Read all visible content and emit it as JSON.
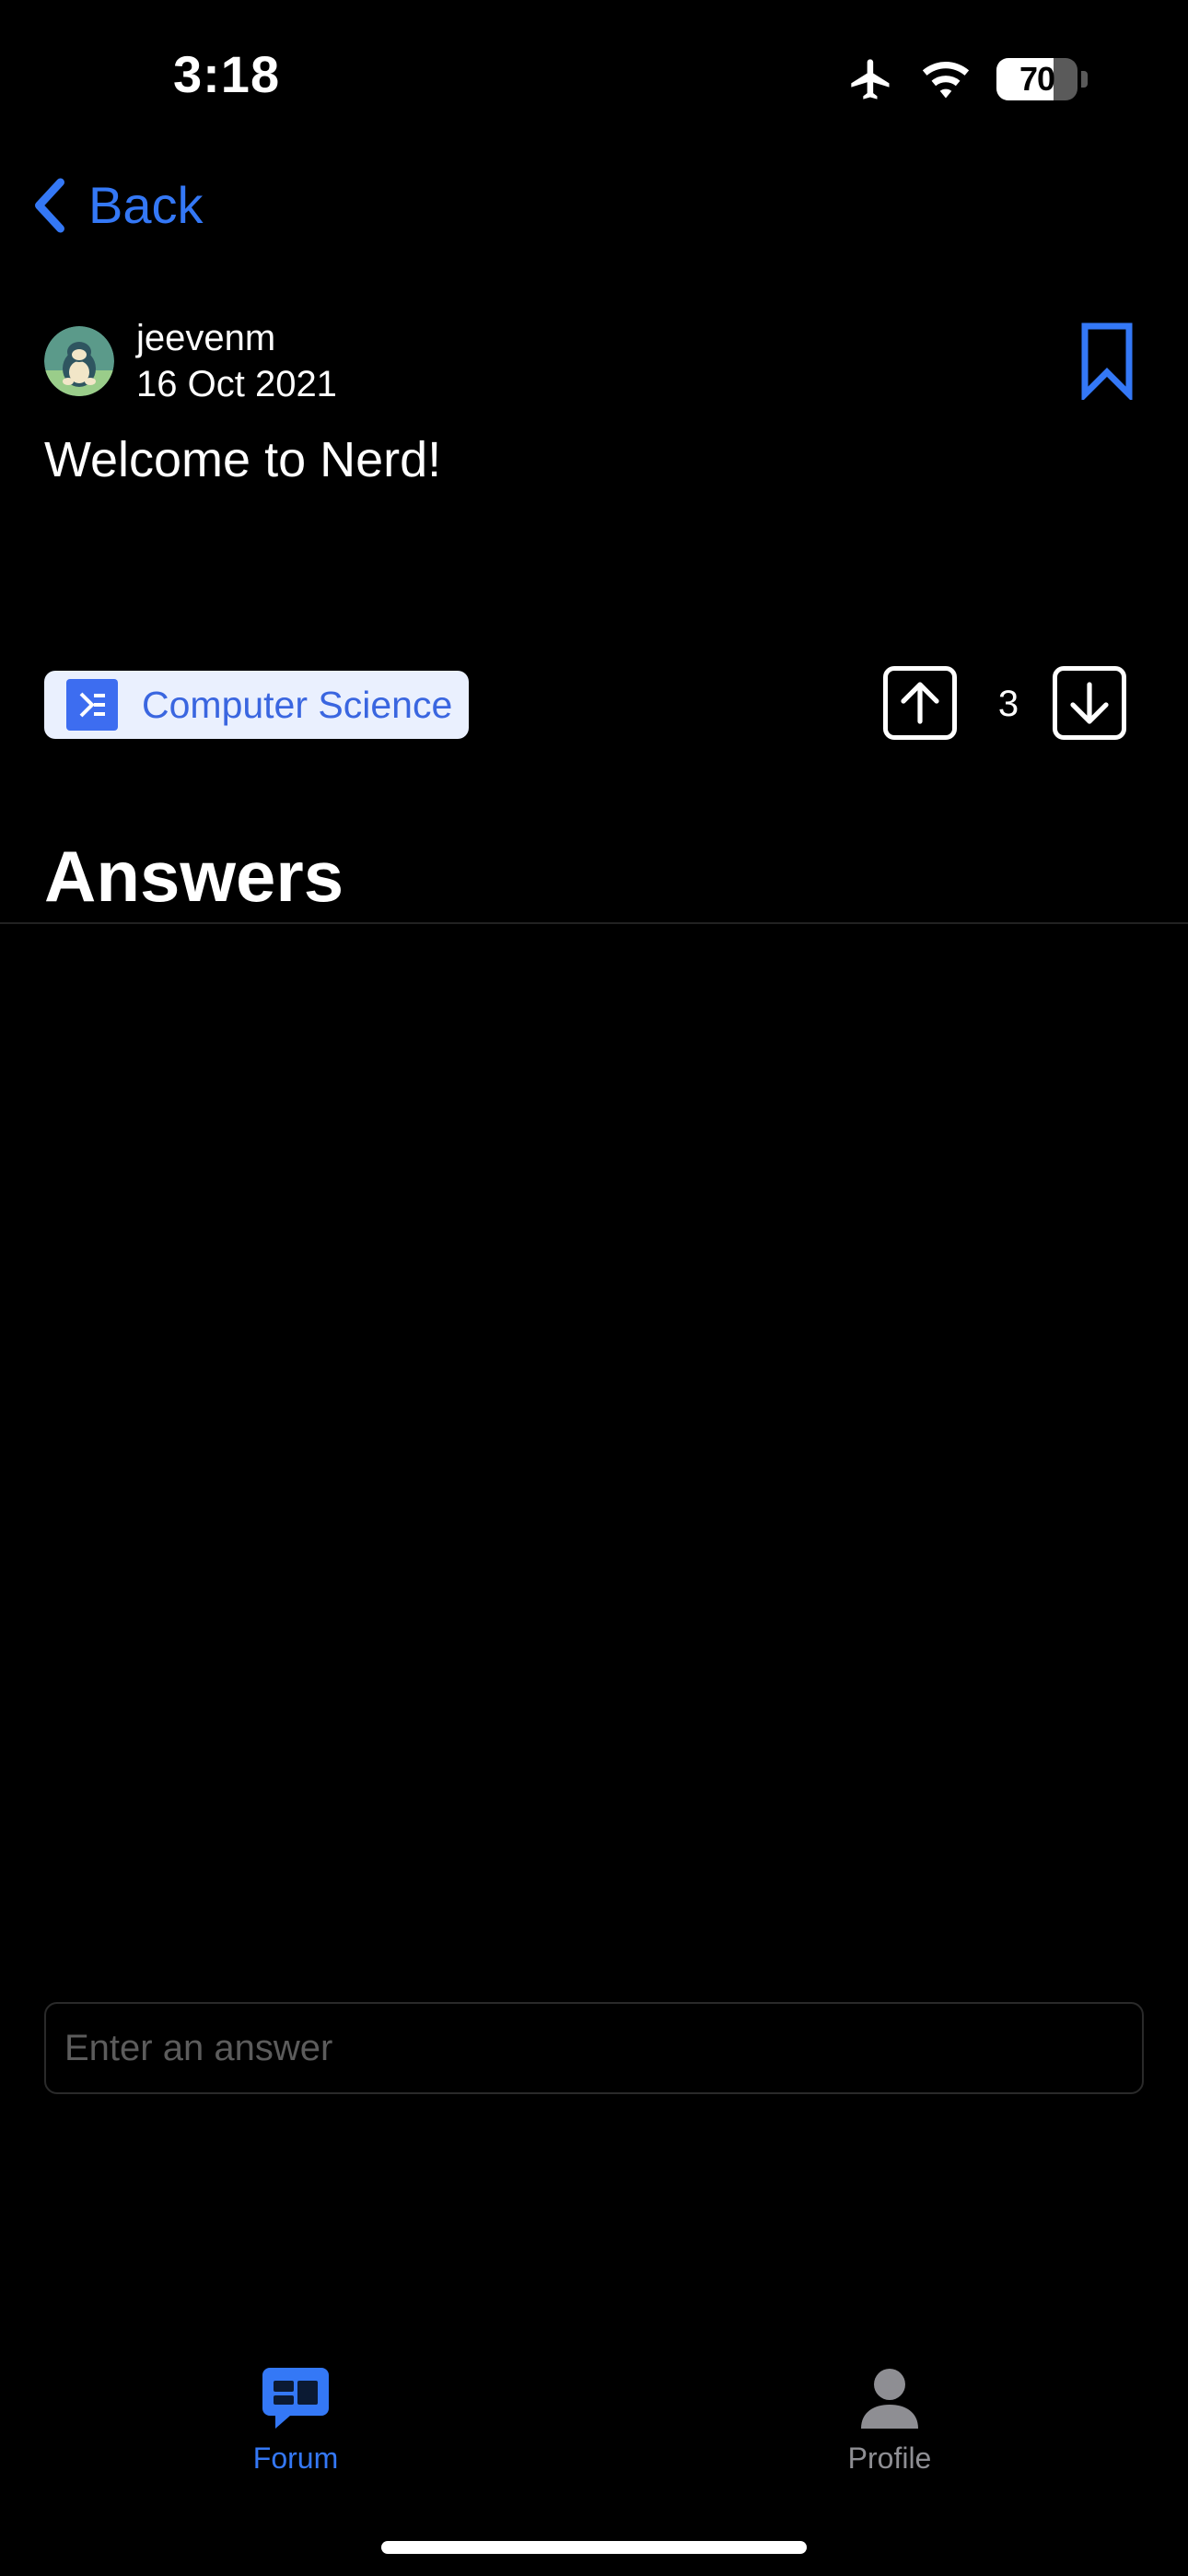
{
  "status_bar": {
    "time": "3:18",
    "battery_level": "70",
    "battery_fraction": 0.7,
    "icons": [
      "airplane-icon",
      "wifi-icon",
      "battery-icon"
    ]
  },
  "nav": {
    "back_label": "Back"
  },
  "post": {
    "author": "jeevenm",
    "date": "16 Oct 2021",
    "title": "Welcome to Nerd!",
    "tag": "Computer Science",
    "vote_count": "3"
  },
  "answers": {
    "heading": "Answers",
    "input_placeholder": "Enter an answer"
  },
  "tabbar": {
    "forum_label": "Forum",
    "profile_label": "Profile"
  },
  "colors": {
    "accent": "#3478f6",
    "tag_bg": "#eaf0fe",
    "tag_text": "#3a66e0",
    "inactive_tab": "#8e8e93"
  }
}
